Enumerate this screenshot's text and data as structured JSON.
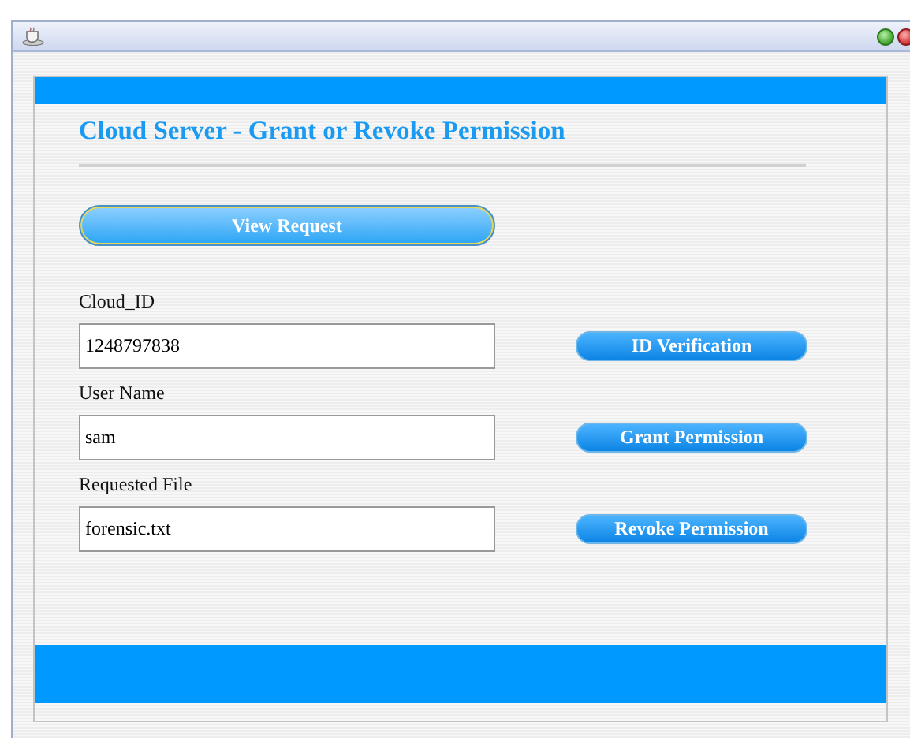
{
  "heading": "Cloud Server - Grant or Revoke Permission",
  "view_button": "View Request",
  "fields": [
    {
      "label": "Cloud_ID",
      "value": "1248797838",
      "button": "ID Verification"
    },
    {
      "label": "User Name",
      "value": "sam",
      "button": "Grant Permission"
    },
    {
      "label": "Requested File",
      "value": "forensic.txt",
      "button": "Revoke Permission"
    }
  ]
}
